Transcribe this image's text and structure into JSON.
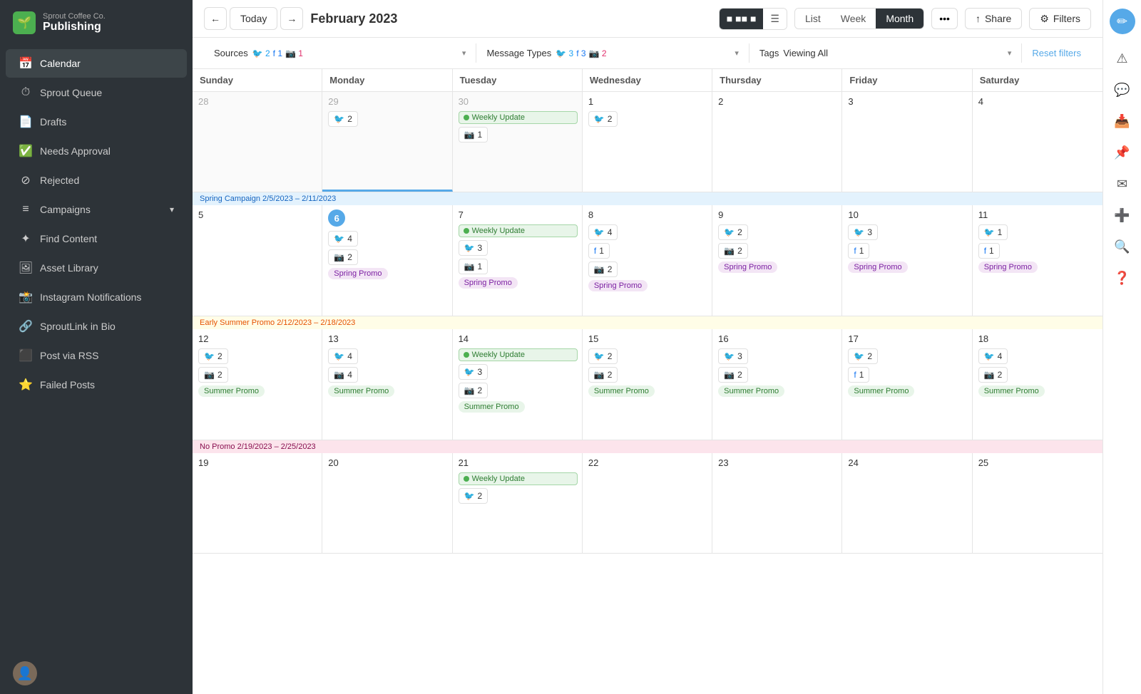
{
  "app": {
    "company": "Sprout Coffee Co.",
    "appName": "Publishing"
  },
  "sidebar": {
    "items": [
      {
        "id": "calendar",
        "label": "Calendar",
        "active": true
      },
      {
        "id": "sprout-queue",
        "label": "Sprout Queue"
      },
      {
        "id": "drafts",
        "label": "Drafts"
      },
      {
        "id": "needs-approval",
        "label": "Needs Approval"
      },
      {
        "id": "rejected",
        "label": "Rejected"
      },
      {
        "id": "campaigns",
        "label": "Campaigns",
        "hasChevron": true
      },
      {
        "id": "find-content",
        "label": "Find Content"
      },
      {
        "id": "asset-library",
        "label": "Asset Library"
      },
      {
        "id": "instagram-notifications",
        "label": "Instagram Notifications"
      },
      {
        "id": "sproutlink",
        "label": "SproutLink in Bio"
      },
      {
        "id": "post-rss",
        "label": "Post via RSS"
      },
      {
        "id": "failed-posts",
        "label": "Failed Posts"
      }
    ]
  },
  "toolbar": {
    "todayLabel": "Today",
    "monthTitle": "February 2023",
    "viewToggle": [
      "grid-icon",
      "list-icon"
    ],
    "viewTabs": [
      "List",
      "Week",
      "Month"
    ],
    "activeTab": "Month",
    "dotsLabel": "•••",
    "shareLabel": "Share",
    "filtersLabel": "Filters"
  },
  "filters": {
    "sources": {
      "label": "Sources",
      "counts": [
        {
          "platform": "twitter",
          "count": 2
        },
        {
          "platform": "facebook",
          "count": 1
        },
        {
          "platform": "instagram",
          "count": 1
        }
      ]
    },
    "messageTypes": {
      "label": "Message Types",
      "counts": [
        {
          "platform": "twitter",
          "count": 3
        },
        {
          "platform": "facebook",
          "count": 3
        },
        {
          "platform": "instagram",
          "count": 2
        }
      ]
    },
    "tags": {
      "label": "Tags",
      "value": "Viewing All"
    },
    "resetLabel": "Reset filters"
  },
  "calendar": {
    "dayHeaders": [
      "Sunday",
      "Monday",
      "Tuesday",
      "Wednesday",
      "Thursday",
      "Friday",
      "Saturday"
    ],
    "campaigns": {
      "spring": "Spring Campaign 2/5/2023 – 2/11/2023",
      "summer": "Early Summer Promo 2/12/2023 – 2/18/2023",
      "nopromo": "No Promo 2/19/2023 – 2/25/2023"
    },
    "weeklyUpdateLabel": "Weekly Update"
  }
}
